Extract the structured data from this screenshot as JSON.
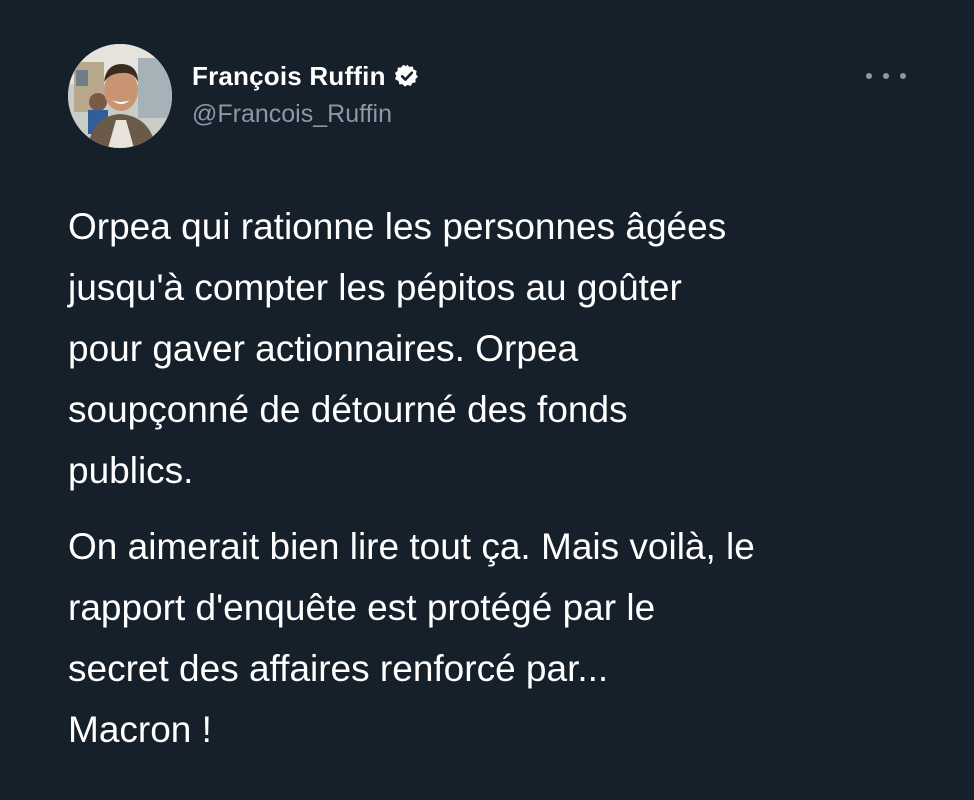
{
  "tweet": {
    "author": {
      "display_name": "François Ruffin",
      "handle": "@Francois_Ruffin",
      "verified": true,
      "avatar_icon": "profile-photo"
    },
    "more_icon": "more-horizontal-icon",
    "paragraphs": [
      {
        "lines": [
          "Orpea qui rationne les personnes âgées",
          "jusqu'à compter les pépitos au goûter",
          "pour gaver actionnaires. Orpea",
          "soupçonné de détourné des fonds",
          "publics."
        ]
      },
      {
        "lines": [
          "On aimerait bien lire tout ça. Mais voilà, le",
          "rapport d'enquête est protégé par le",
          "secret des affaires renforcé par...",
          "Macron !"
        ]
      }
    ]
  },
  "colors": {
    "background": "#15202b",
    "text_primary": "#ffffff",
    "text_secondary": "#8b98a5"
  }
}
